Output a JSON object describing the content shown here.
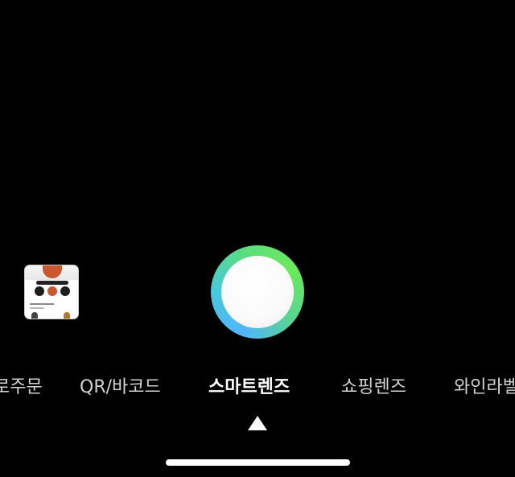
{
  "camera": {
    "modes": [
      {
        "label": "로주문",
        "active": false
      },
      {
        "label": "QR/바코드",
        "active": false
      },
      {
        "label": "스마트렌즈",
        "active": true
      },
      {
        "label": "쇼핑렌즈",
        "active": false
      },
      {
        "label": "와인라벨",
        "active": false
      }
    ],
    "shutter_colors": {
      "ring_start": "#4fb6ff",
      "ring_end": "#6bea5a",
      "inner": "#ffffff"
    },
    "background": "#000000"
  },
  "icons": {
    "gallery_thumbnail": "gallery-thumbnail-icon",
    "active_mode_indicator": "up-triangle-icon"
  }
}
